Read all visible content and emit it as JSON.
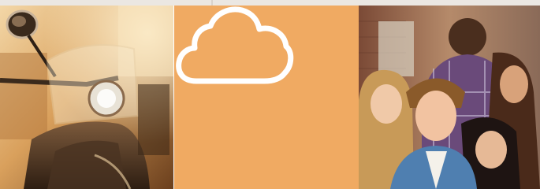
{
  "tiles": [
    {
      "icon": "scooter-photo",
      "kind": "photo"
    },
    {
      "icon": "cloud-icon",
      "kind": "icon",
      "background": "#f0aa62",
      "stroke": "#ffffff"
    },
    {
      "icon": "group-selfie-photo",
      "kind": "photo"
    }
  ],
  "colors": {
    "accent_orange": "#f0aa62",
    "warm_photo_tone": "#c98a45",
    "top_strip": "#ebe7e2"
  }
}
